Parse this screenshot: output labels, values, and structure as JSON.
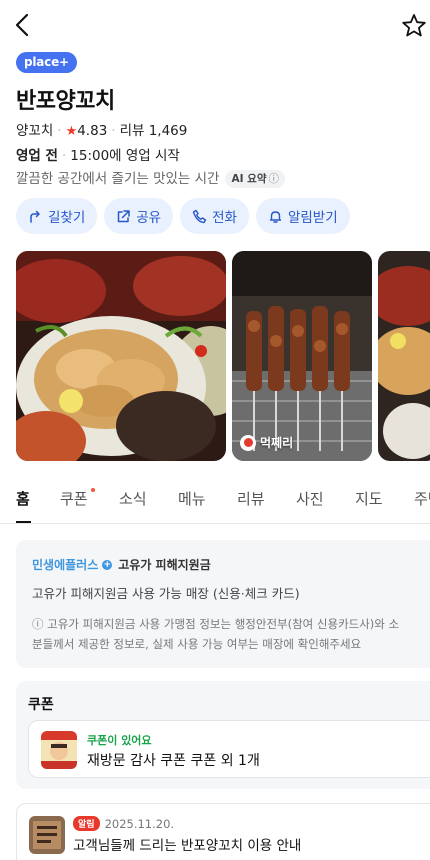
{
  "header": {
    "back_icon": "chevron-left-icon",
    "bookmark_icon": "star-outline-icon"
  },
  "place": {
    "badge": "place+",
    "name": "반포양꼬치",
    "category": "양꼬치",
    "rating": "4.83",
    "reviews": "리뷰 1,469",
    "status": "영업 전",
    "open_info": "15:00에 영업 시작",
    "summary": "깔끔한 공간에서 즐기는 맛있는 시간",
    "ai_label": "AI 요약",
    "ai_info": "ⓘ"
  },
  "actions": [
    {
      "label": "길찾기",
      "icon": "directions-icon"
    },
    {
      "label": "공유",
      "icon": "share-icon"
    },
    {
      "label": "전화",
      "icon": "phone-icon"
    },
    {
      "label": "알림받기",
      "icon": "bell-icon"
    }
  ],
  "photos": {
    "tag": "먹쩨리"
  },
  "tabs": [
    "홈",
    "쿠폰",
    "소식",
    "메뉴",
    "리뷰",
    "사진",
    "지도",
    "주변"
  ],
  "active_tab": "홈",
  "notice": {
    "brand": "민생에플러스",
    "brand_sub": "고유가 피해지원금",
    "desc": "고유가 피해지원금 사용 가능 매장 (신용·체크 카드)",
    "fine1": "ⓘ 고유가 피해지원금 사용 가맹점 정보는 행정안전부(참여 신용카드사)와 소",
    "fine2": "분들께서 제공한 정보로, 실제 사용 가능 여부는 매장에 확인해주세요"
  },
  "coupon": {
    "section_title": "쿠폰",
    "tag": "쿠폰이 있어요",
    "title": "재방문 감사 쿠폰 쿠폰 외 1개"
  },
  "news": {
    "badge": "알림",
    "date": "2025.11.20.",
    "title": "고객님들께 드리는 반포양꼬치 이용 안내"
  },
  "colors": {
    "brand_blue": "#4472f0",
    "action_bg": "#e8f1fd",
    "action_text": "#2857c9",
    "rating_star": "#f03a28",
    "coupon_green": "#17a34a"
  }
}
